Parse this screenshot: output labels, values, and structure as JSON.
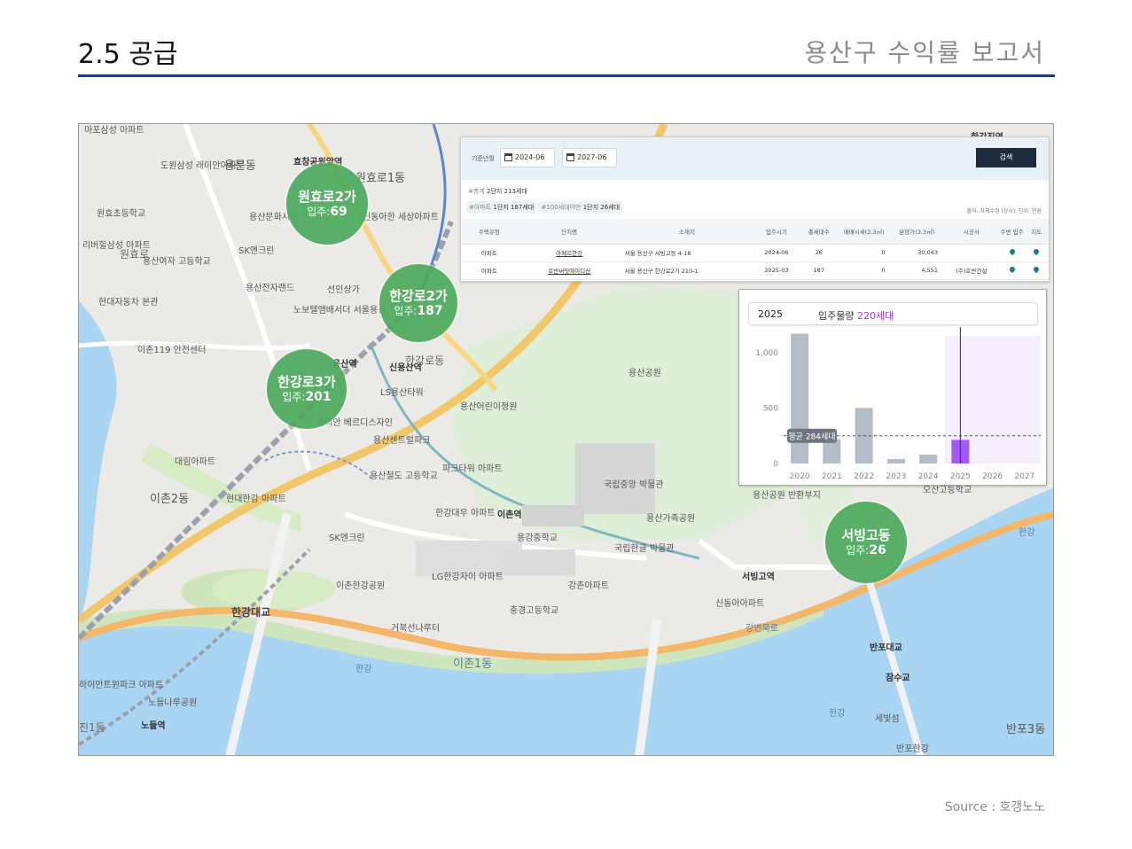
{
  "slide": {
    "title": "2.5 공급",
    "subtitle": "용산구 수익률 보고서",
    "source": "Source : 호갱노노"
  },
  "colors": {
    "rule": "#1f3a7a",
    "cluster": "#4eaa5c",
    "highlight_bar": "#a259f7",
    "bar": "#b4bcc8"
  },
  "clusters": [
    {
      "name": "원효로2가",
      "count_label": "입주:",
      "count": "69"
    },
    {
      "name": "한강로2가",
      "count_label": "입주:",
      "count": "187"
    },
    {
      "name": "한강로3가",
      "count_label": "입주:",
      "count": "201"
    },
    {
      "name": "서빙고동",
      "count_label": "입주:",
      "count": "26"
    }
  ],
  "map_labels": {
    "areas": [
      "마포삼성 아파트",
      "도원삼성 래미안아파트",
      "용문동",
      "효창공원앞역",
      "원효로1동",
      "원효초등학교",
      "용산문화시장",
      "신동아한 세상아파트",
      "리버힐삼성 아파트",
      "원효로",
      "용산여자 고등학교",
      "SK엔크린",
      "용산전자랜드",
      "선인상가",
      "노보텔앰배서더 서울용산",
      "현대자동차 본관",
      "이촌119 안전센터",
      "용산역",
      "신용산역",
      "한강로동",
      "LS용산타워",
      "용산공원",
      "용산어린이정원",
      "래미안 베르디스자인",
      "용산센트럴파크",
      "대림아파트",
      "용산철도 고등학교",
      "파크타워 아파트",
      "국립중앙 박물관",
      "이촌2동",
      "현대한강 아파트",
      "한강대우 아파트",
      "이촌역",
      "용강중학교",
      "용산가족공원",
      "국립한글 박물관",
      "SK엔크린",
      "이촌한강공원",
      "LG한강자이 아파트",
      "강촌아파트",
      "서빙고역",
      "신동아아파트",
      "용산공원 반환부지",
      "오산고등학교",
      "한강대교",
      "거북선나루터",
      "충경고등학교",
      "이촌1동",
      "한강",
      "강변북로",
      "반포대교",
      "잠수교",
      "세빛섬",
      "반포3동",
      "노들나루공원",
      "노들역",
      "한강",
      "한강",
      "한강진역",
      "하이안트윈파크 아파트",
      "진1동",
      "반포한강"
    ],
    "roads": [
      "6호선",
      "4호선",
      "경의중앙선"
    ]
  },
  "panel": {
    "filter_label": "기준년월",
    "date_from": "2024-06",
    "date_to": "2027-06",
    "search_button": "검색",
    "summary_total_tag": "#총계",
    "summary_total": "2단지 213세대",
    "summary_apt_tag": "#아파트",
    "summary_apt": "1단지 187세대",
    "summary_small_tag": "#100세대미만",
    "summary_small": "1단지 26세대",
    "note": "출처: 자체수집 (상시), 단위: 만원",
    "headers": [
      "주택유형",
      "단지명",
      "소재지",
      "입주시기",
      "총세대수",
      "매매시세(3.3㎡)",
      "분양가(3.3㎡)",
      "시공사",
      "주변 입주",
      "지도"
    ],
    "rows": [
      {
        "type": "아파트",
        "name": "아페르한강",
        "address": "서울 용산구 서빙고동 4-18",
        "move_in": "2024-06",
        "units": "26",
        "sale_price": "0",
        "presale_price": "30,043",
        "builder": ""
      },
      {
        "type": "아파트",
        "name": "호반써밋에이디션",
        "address": "서울 용산구 한강로2가 210-1",
        "move_in": "2025-03",
        "units": "187",
        "sale_price": "0",
        "presale_price": "4,551",
        "builder": "(주)호반건설"
      }
    ]
  },
  "chart_header": {
    "year": "2025",
    "label": "입주물량",
    "value": "220세대"
  },
  "chart_data": {
    "type": "bar",
    "title": "입주물량",
    "categories": [
      "2020",
      "2021",
      "2022",
      "2023",
      "2024",
      "2025",
      "2026",
      "2027"
    ],
    "values": [
      1170,
      220,
      500,
      40,
      80,
      213,
      0,
      0
    ],
    "highlight": "2025",
    "ylim": [
      0,
      1150
    ],
    "yticks": [
      "0",
      "500",
      "1,000"
    ],
    "average_label": "평균 284세대",
    "average": 250,
    "xlabel": "",
    "ylabel": "",
    "grid": false
  }
}
